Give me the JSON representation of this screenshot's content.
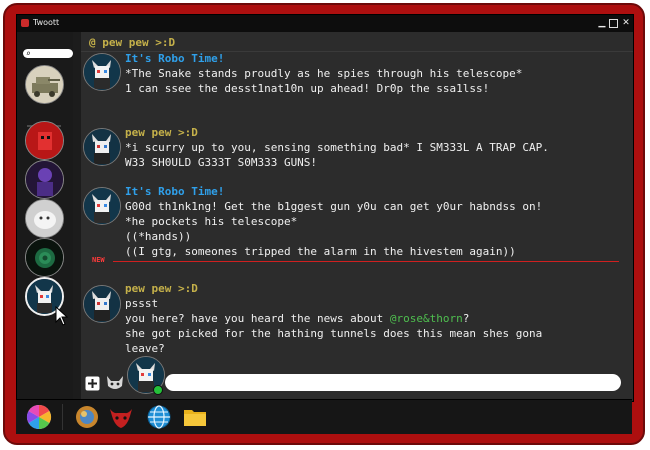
{
  "window": {
    "title": "Twoott",
    "min_glyph": "▁",
    "max_glyph": "▢",
    "close_glyph": "✕"
  },
  "sidebar": {
    "search_glyph": "⌕",
    "search_placeholder": "",
    "servers": [
      {
        "name": "server-tank"
      },
      {
        "name": "server-red"
      },
      {
        "name": "server-purple"
      },
      {
        "name": "server-white"
      },
      {
        "name": "server-rose"
      },
      {
        "name": "server-robo"
      }
    ]
  },
  "chat": {
    "channel": "@ pew pew >:D",
    "new_label": "NEW",
    "colors": {
      "robo": "#2fa0ea",
      "pew": "#c5b14a",
      "mention": "#4fbf4f",
      "new": "#d02020"
    },
    "messages": [
      {
        "author": "It's Robo Time!",
        "lines": [
          "*The Snake stands proudly as he spies through his telescope*",
          "1 can ssee the desst1nat10n up ahead! Dr0p the ssa1lss!"
        ]
      },
      {
        "author": "pew pew >:D",
        "lines": [
          "*i scurry up to you, sensing something bad* I SM333L A TRAP CAP.",
          "W33 SH0ULD G333T S0M333 GUNS!"
        ]
      },
      {
        "author": "It's Robo Time!",
        "lines": [
          "G00d th1nk1ng! Get the b1ggest gun y0u can get y0ur habndss on!",
          "*he pockets his telescope*",
          "((*hands))",
          "((I gtg, someones tripped the alarm in the hivestem again))"
        ]
      },
      {
        "author": "pew pew >:D",
        "lines": [
          "pssst",
          "you here? have you heard the news about ",
          "she got picked for the hathing tunnels does this mean shes gona",
          "leave?"
        ],
        "mention": "@rose&thorn",
        "mention_suffix": "?"
      }
    ]
  },
  "input": {
    "placeholder": "",
    "value": ""
  },
  "taskbar": {
    "apps": [
      {
        "name": "color-wheel"
      },
      {
        "name": "planet"
      },
      {
        "name": "bull"
      },
      {
        "name": "globe"
      },
      {
        "name": "folder"
      }
    ]
  }
}
